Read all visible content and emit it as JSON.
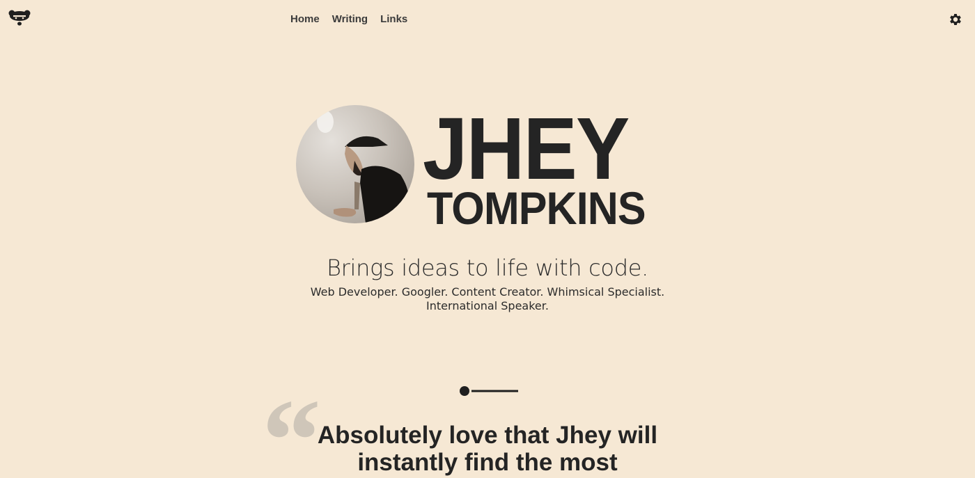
{
  "header": {
    "logo_icon": "bear-logo-icon",
    "nav": [
      {
        "label": "Home"
      },
      {
        "label": "Writing"
      },
      {
        "label": "Links"
      }
    ],
    "settings_icon": "gear-icon"
  },
  "hero": {
    "avatar": "profile-photo",
    "name_first": "JHEY",
    "name_last": "TOMPKINS",
    "tagline": "Brings ideas to life with code.",
    "roles_line1": "Web Developer. Googler. Content Creator. Whimsical Specialist.",
    "roles_line2": "International Speaker."
  },
  "testimonial": {
    "quote_mark": "“",
    "text_line1": "Absolutely love that Jhey will",
    "text_line2": "instantly find the most"
  },
  "colors": {
    "background": "#f6e8d4",
    "text": "#242424",
    "quote_mark": "#cfc6b9"
  }
}
